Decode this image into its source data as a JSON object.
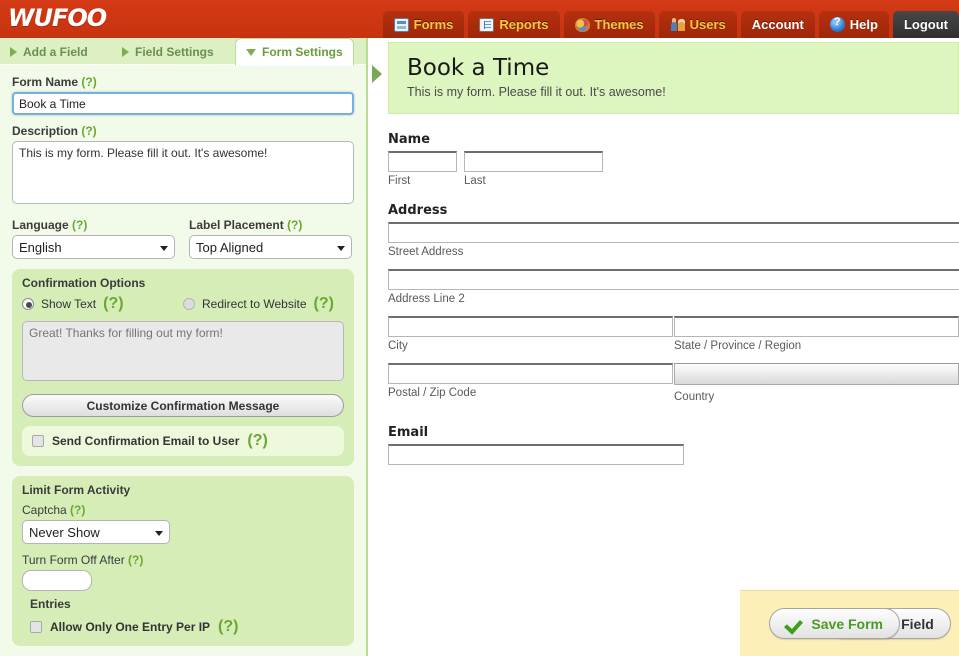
{
  "app": {
    "logo": "WUFOO"
  },
  "nav": {
    "items": [
      {
        "label": "Forms",
        "icon": "forms-icon",
        "style": "accent",
        "active": true
      },
      {
        "label": "Reports",
        "icon": "reports-icon",
        "style": "accent",
        "active": false
      },
      {
        "label": "Themes",
        "icon": "themes-icon",
        "style": "accent",
        "active": false
      },
      {
        "label": "Users",
        "icon": "users-icon",
        "style": "accent",
        "active": false
      },
      {
        "label": "Account",
        "icon": "",
        "style": "plain",
        "active": false
      },
      {
        "label": "Help",
        "icon": "help-icon",
        "style": "plain",
        "active": false
      },
      {
        "label": "Logout",
        "icon": "",
        "style": "logout",
        "active": false
      }
    ]
  },
  "builder_tabs": [
    {
      "label": "Add a Field",
      "state": "collapsed"
    },
    {
      "label": "Field Settings",
      "state": "collapsed"
    },
    {
      "label": "Form Settings",
      "state": "expanded"
    }
  ],
  "form_settings": {
    "form_name": {
      "label": "Form Name",
      "help": "(?)",
      "value": "Book a Time",
      "focused": true
    },
    "description": {
      "label": "Description",
      "help": "(?)",
      "value": "This is my form. Please fill it out. It's awesome!"
    },
    "language": {
      "label": "Language",
      "help": "(?)",
      "value": "English"
    },
    "label_placement": {
      "label": "Label Placement",
      "help": "(?)",
      "value": "Top Aligned"
    },
    "confirmation": {
      "title": "Confirmation Options",
      "help": "(?)",
      "show_text_label": "Show Text",
      "redirect_label": "Redirect to Website",
      "selected": "show_text",
      "message_placeholder": "Great! Thanks for filling out my form!",
      "customize_button": "Customize Confirmation Message",
      "send_email_label": "Send Confirmation Email to User",
      "send_email_checked": false
    },
    "limit_activity": {
      "title": "Limit Form Activity",
      "captcha_label": "Captcha",
      "captcha_value": "Never Show",
      "turn_off_label": "Turn Form Off After",
      "turn_off_value": "",
      "entries_label": "Entries",
      "one_entry_label": "Allow Only One Entry Per IP",
      "one_entry_checked": false,
      "help": "(?)"
    }
  },
  "preview": {
    "title": "Book a Time",
    "description": "This is my form. Please fill it out. It's awesome!",
    "fields": [
      {
        "label": "Name",
        "type": "name",
        "parts": [
          {
            "sub": "First",
            "value": ""
          },
          {
            "sub": "Last",
            "value": ""
          }
        ]
      },
      {
        "label": "Address",
        "type": "address",
        "parts": [
          {
            "sub": "Street Address",
            "value": "",
            "control": "text"
          },
          {
            "sub": "Address Line 2",
            "value": "",
            "control": "text"
          },
          {
            "sub": "City",
            "value": "",
            "control": "text"
          },
          {
            "sub": "State / Province / Region",
            "value": "",
            "control": "text"
          },
          {
            "sub": "Postal / Zip Code",
            "value": "",
            "control": "text"
          },
          {
            "sub": "Country",
            "value": "",
            "control": "select"
          }
        ]
      },
      {
        "label": "Email",
        "type": "email",
        "parts": [
          {
            "sub": "",
            "value": ""
          }
        ]
      }
    ]
  },
  "footer": {
    "add_field": "Add Field",
    "save_form": "Save Form"
  }
}
